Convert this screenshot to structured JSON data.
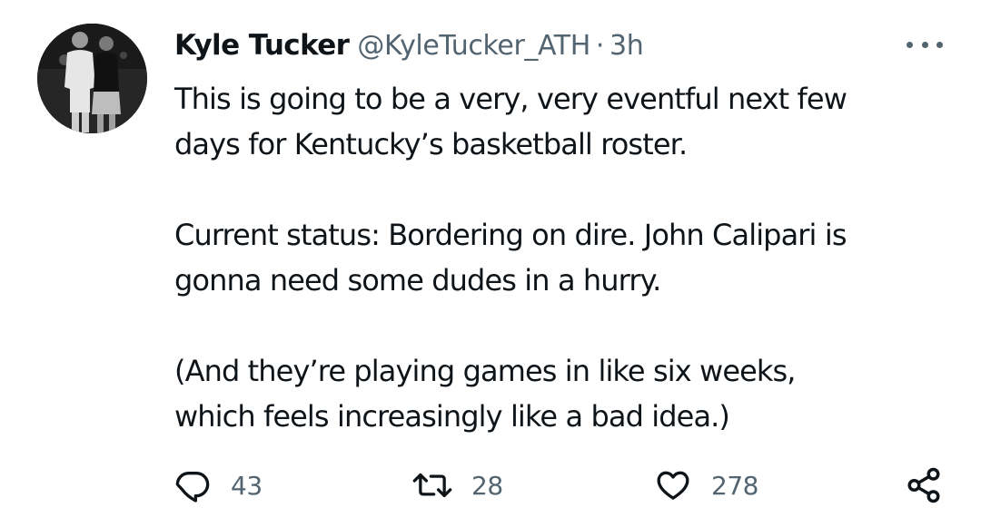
{
  "tweet": {
    "display_name": "Kyle Tucker",
    "handle": "@KyleTucker_ATH",
    "separator": "·",
    "time": "3h",
    "paragraphs": [
      "This is going to be a very, very eventful next few\ndays for Kentucky’s basketball roster.",
      "Current status: Bordering on dire. John Calipari is\ngonna need some dudes in a hurry.",
      "(And they’re playing games in like six weeks,\nwhich feels increasingly like a bad idea.)"
    ],
    "stats": {
      "replies": "43",
      "retweets": "28",
      "likes": "278"
    }
  },
  "icons": {
    "reply": "reply-icon",
    "retweet": "retweet-icon",
    "like": "heart-icon",
    "share": "share-icon",
    "more": "more-options-icon"
  },
  "colors": {
    "text_primary": "#0f1419",
    "text_secondary": "#536471",
    "background": "#ffffff"
  }
}
